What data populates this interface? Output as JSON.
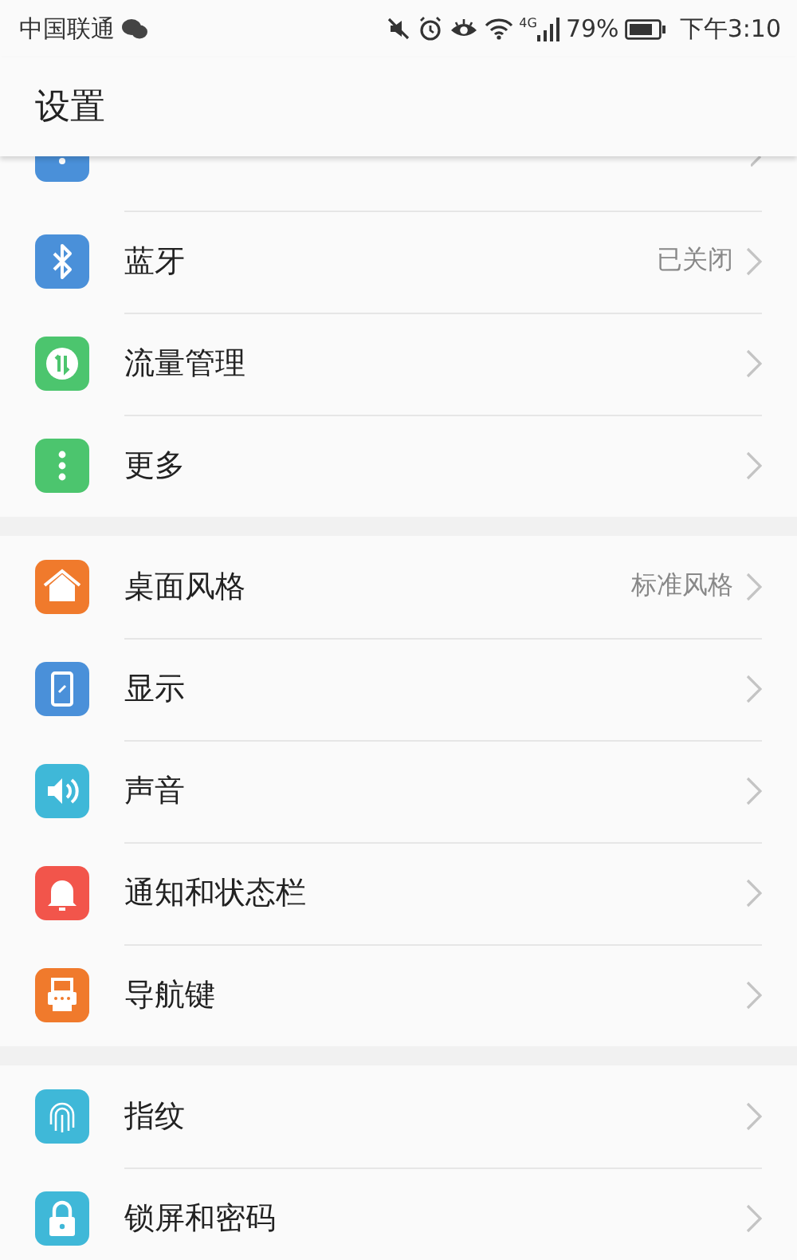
{
  "status_bar": {
    "carrier": "中国联通",
    "network": "4G",
    "battery": "79%",
    "time": "下午3:10"
  },
  "header": {
    "title": "设置"
  },
  "sections": [
    {
      "items": [
        {
          "kind": "clipped"
        },
        {
          "kind": "full",
          "label": "蓝牙",
          "value": "已关闭"
        },
        {
          "kind": "full",
          "label": "流量管理"
        },
        {
          "kind": "full",
          "label": "更多"
        }
      ]
    },
    {
      "items": [
        {
          "kind": "full",
          "label": "桌面风格",
          "value": "标准风格"
        },
        {
          "kind": "full",
          "label": "显示"
        },
        {
          "kind": "full",
          "label": "声音"
        },
        {
          "kind": "full",
          "label": "通知和状态栏"
        },
        {
          "kind": "full",
          "label": "导航键"
        }
      ]
    },
    {
      "items": [
        {
          "kind": "full",
          "label": "指纹"
        },
        {
          "kind": "full",
          "label": "锁屏和密码"
        }
      ]
    }
  ]
}
